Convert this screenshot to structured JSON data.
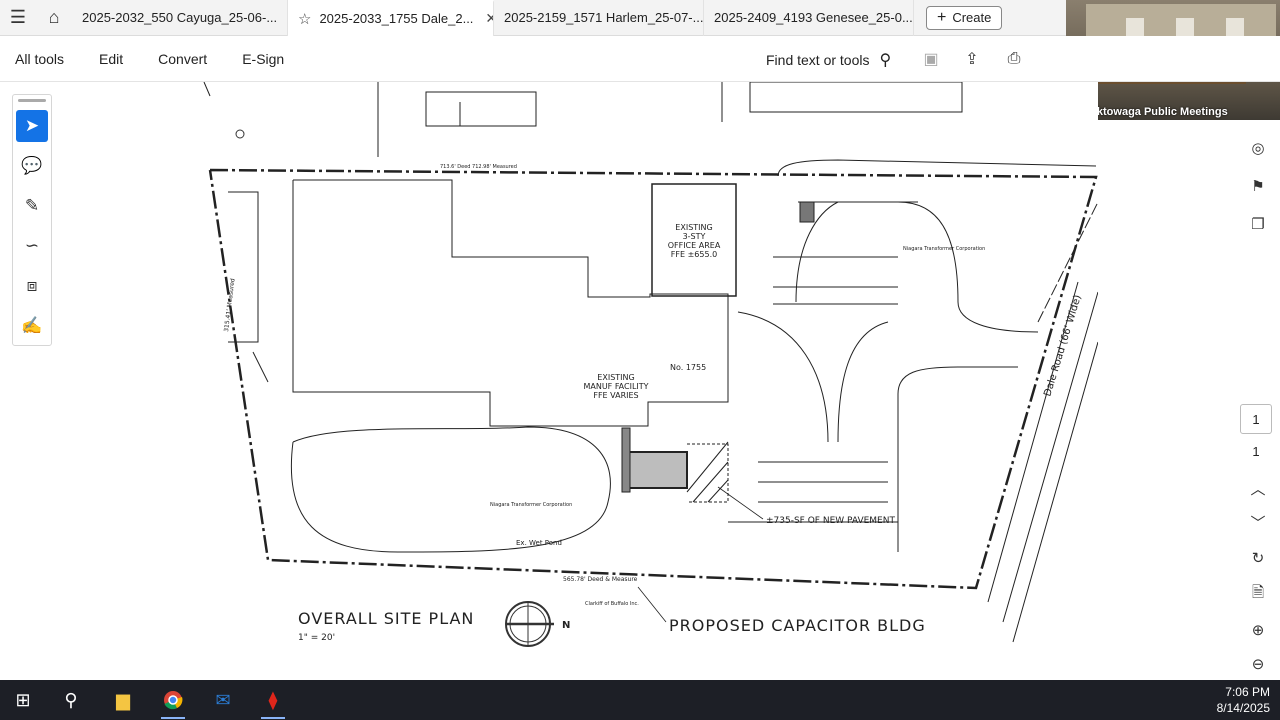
{
  "tabs": [
    {
      "label": "2025-2032_550 Cayuga_25-06-...",
      "active": false
    },
    {
      "label": "2025-2033_1755 Dale_2...",
      "active": true
    },
    {
      "label": "2025-2159_1571 Harlem_25-07-...",
      "active": false
    },
    {
      "label": "2025-2409_4193 Genesee_25-0...",
      "active": false
    }
  ],
  "create_label": "Create",
  "video_caption": "Cheektowaga Public Meetings",
  "menu": [
    "All tools",
    "Edit",
    "Convert",
    "E-Sign"
  ],
  "find_label": "Find text or tools",
  "page_current": "1",
  "page_total": "1",
  "drawing": {
    "overall_title": "OVERALL SITE PLAN",
    "scale": "1\" = 20'",
    "proposed_title": "PROPOSED CAPACITOR BLDG",
    "pavement_note": "±735-SF OF NEW PAVEMENT",
    "office_lines": [
      "EXISTING",
      "3-STY",
      "OFFICE AREA",
      "FFE ±655.0"
    ],
    "manuf_lines": [
      "EXISTING",
      "MANUF FACILITY",
      "FFE VARIES"
    ],
    "address_no": "No. 1755",
    "road": "Dale Road (66' Wide)",
    "wet_pond": "Ex. Wet Pond",
    "north": "N",
    "owner_top": "Niagara Transformer Corporation",
    "owner_bottom": "Niagara Transformer Corporation",
    "bottom_meas": "565.78' Deed & Measure",
    "top_meas": "713.6' Deed 712.98' Measured",
    "left_meas": "315.41' Measured",
    "neighbor": "Clarkiff of Buffalo Inc."
  },
  "clock": {
    "time": "7:06 PM",
    "date": "8/14/2025"
  }
}
